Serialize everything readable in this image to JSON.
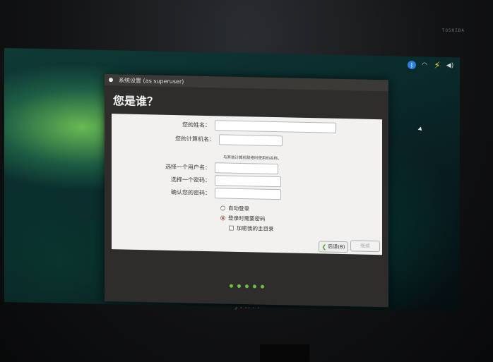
{
  "tv": {
    "brand_top": "TOSHIBA",
    "brand_bottom": "JTHTP"
  },
  "panel": {
    "tray_icons": [
      "bluetooth-icon",
      "wifi-icon",
      "battery-charging-icon",
      "volume-icon"
    ]
  },
  "window": {
    "title": "系统设置 (as superuser)"
  },
  "page": {
    "heading": "您是谁？"
  },
  "form": {
    "name_label": "您的姓名：",
    "name_value": "",
    "computer_label": "您的计算机名：",
    "computer_value": "",
    "computer_hint": "与其他计算机联络时使用的名称。",
    "username_label": "选择一个用户名：",
    "username_value": "",
    "password_label": "选择一个密码：",
    "password_value": "",
    "confirm_label": "确认您的密码：",
    "confirm_value": "",
    "auto_login_label": "自动登录",
    "require_password_label": "登录时需要密码",
    "encrypt_home_label": "加密我的主目录",
    "selected_login_option": "require_password",
    "encrypt_home_checked": false
  },
  "buttons": {
    "back_label": "后退(B)",
    "continue_label": "继续"
  },
  "progress": {
    "steps": 5,
    "current": 5
  },
  "colors": {
    "accent": "#dd4814",
    "progress_dot": "#6ac045"
  }
}
